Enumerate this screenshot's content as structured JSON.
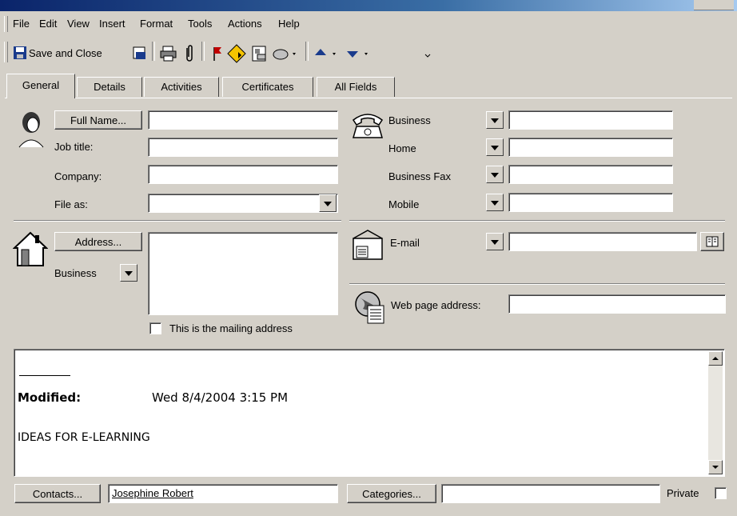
{
  "menu": {
    "items": [
      "File",
      "Edit",
      "View",
      "Insert",
      "Format",
      "Tools",
      "Actions",
      "Help"
    ]
  },
  "toolbar": {
    "save_close_label": "Save and Close"
  },
  "tabs": [
    {
      "label": "General"
    },
    {
      "label": "Details"
    },
    {
      "label": "Activities"
    },
    {
      "label": "Certificates"
    },
    {
      "label": "All Fields"
    }
  ],
  "name_section": {
    "full_name_button": "Full Name...",
    "full_name_value": "",
    "job_title_label": "Job title:",
    "company_label": "Company:",
    "file_as_label": "File as:"
  },
  "phone_section": {
    "phones": [
      {
        "label": "Business"
      },
      {
        "label": "Home"
      },
      {
        "label": "Business Fax"
      },
      {
        "label": "Mobile"
      }
    ]
  },
  "address_section": {
    "address_button": "Address...",
    "address_type": "Business",
    "mailing_checkbox_label": "This is the mailing address"
  },
  "email_section": {
    "email_label": "E-mail",
    "web_label": "Web page address:"
  },
  "notes": {
    "modified_label": "Modified:",
    "modified_value": "Wed 8/4/2004 3:15 PM",
    "body_text": "IDEAS FOR E-LEARNING"
  },
  "footer": {
    "contacts_button": "Contacts...",
    "contacts_value": "Josephine Robert",
    "categories_button": "Categories...",
    "categories_value": "",
    "private_label": "Private"
  }
}
